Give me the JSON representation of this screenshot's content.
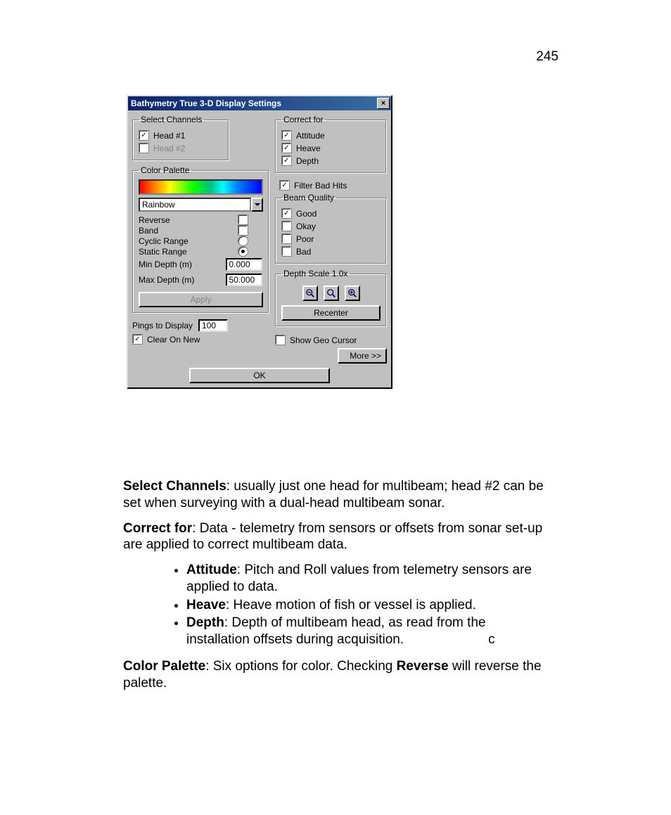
{
  "page_number": "245",
  "dialog": {
    "title": "Bathymetry True 3-D Display Settings",
    "close_glyph": "×",
    "select_channels": {
      "legend": "Select Channels",
      "head1": "Head #1",
      "head2": "Head #2"
    },
    "correct_for": {
      "legend": "Correct for",
      "attitude": "Attitude",
      "heave": "Heave",
      "depth": "Depth"
    },
    "filter_bad_hits": "Filter Bad Hits",
    "beam_quality": {
      "legend": "Beam Quality",
      "good": "Good",
      "okay": "Okay",
      "poor": "Poor",
      "bad": "Bad"
    },
    "color_palette": {
      "legend": "Color Palette",
      "selected": "Rainbow",
      "reverse": "Reverse",
      "band": "Band",
      "cyclic_range": "Cyclic Range",
      "static_range": "Static Range",
      "min_depth_label": "Min Depth (m)",
      "min_depth_value": "0.000",
      "max_depth_label": "Max Depth (m)",
      "max_depth_value": "50.000",
      "apply": "Apply"
    },
    "depth_scale": {
      "legend": "Depth Scale 1.0x"
    },
    "recenter": "Recenter",
    "pings_label": "Pings to Display",
    "pings_value": "100",
    "clear_on_new": "Clear On New",
    "show_geo_cursor": "Show Geo Cursor",
    "more": "More >>",
    "ok": "OK"
  },
  "doc": {
    "p1_b": "Select Channels",
    "p1": ":  usually just one head for multibeam; head #2 can be set when surveying with a dual-head multibeam sonar.",
    "p2_b": "Correct for",
    "p2": ":  Data - telemetry from sensors or offsets from sonar set-up are applied to correct multibeam data.",
    "li1_b": "Attitude",
    "li1": ":  Pitch and Roll values from telemetry sensors are applied to data.",
    "li2_b": "Heave",
    "li2": ":  Heave motion of fish or vessel is applied.",
    "li3_b": "Depth",
    "li3": ":  Depth of multibeam head, as read from the installation offsets during acquisition.",
    "li3_trail": "c",
    "p3_b1": "Color Palette",
    "p3_mid": ":  Six options for color.  Checking ",
    "p3_b2": "Reverse",
    "p3_end": " will reverse the palette."
  }
}
